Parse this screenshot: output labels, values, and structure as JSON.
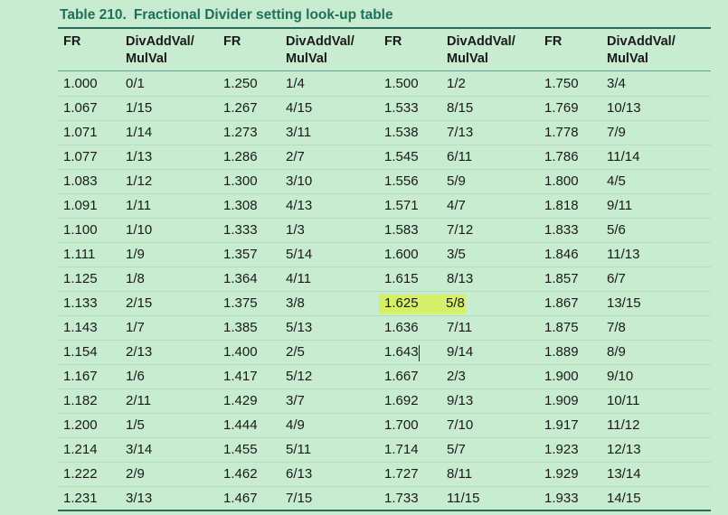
{
  "caption": {
    "number": "Table 210.",
    "title": "Fractional Divider setting look-up table"
  },
  "headers": {
    "fr": "FR",
    "div_line1": "DivAddVal/",
    "div_line2": "MulVal"
  },
  "highlight": {
    "group": 2,
    "row": 9,
    "color": "#d7f06b"
  },
  "groups": [
    {
      "rows": [
        [
          "1.000",
          "0/1"
        ],
        [
          "1.067",
          "1/15"
        ],
        [
          "1.071",
          "1/14"
        ],
        [
          "1.077",
          "1/13"
        ],
        [
          "1.083",
          "1/12"
        ],
        [
          "1.091",
          "1/11"
        ],
        [
          "1.100",
          "1/10"
        ],
        [
          "1.111",
          "1/9"
        ],
        [
          "1.125",
          "1/8"
        ],
        [
          "1.133",
          "2/15"
        ],
        [
          "1.143",
          "1/7"
        ],
        [
          "1.154",
          "2/13"
        ],
        [
          "1.167",
          "1/6"
        ],
        [
          "1.182",
          "2/11"
        ],
        [
          "1.200",
          "1/5"
        ],
        [
          "1.214",
          "3/14"
        ],
        [
          "1.222",
          "2/9"
        ],
        [
          "1.231",
          "3/13"
        ]
      ]
    },
    {
      "rows": [
        [
          "1.250",
          "1/4"
        ],
        [
          "1.267",
          "4/15"
        ],
        [
          "1.273",
          "3/11"
        ],
        [
          "1.286",
          "2/7"
        ],
        [
          "1.300",
          "3/10"
        ],
        [
          "1.308",
          "4/13"
        ],
        [
          "1.333",
          "1/3"
        ],
        [
          "1.357",
          "5/14"
        ],
        [
          "1.364",
          "4/11"
        ],
        [
          "1.375",
          "3/8"
        ],
        [
          "1.385",
          "5/13"
        ],
        [
          "1.400",
          "2/5"
        ],
        [
          "1.417",
          "5/12"
        ],
        [
          "1.429",
          "3/7"
        ],
        [
          "1.444",
          "4/9"
        ],
        [
          "1.455",
          "5/11"
        ],
        [
          "1.462",
          "6/13"
        ],
        [
          "1.467",
          "7/15"
        ]
      ]
    },
    {
      "rows": [
        [
          "1.500",
          "1/2"
        ],
        [
          "1.533",
          "8/15"
        ],
        [
          "1.538",
          "7/13"
        ],
        [
          "1.545",
          "6/11"
        ],
        [
          "1.556",
          "5/9"
        ],
        [
          "1.571",
          "4/7"
        ],
        [
          "1.583",
          "7/12"
        ],
        [
          "1.600",
          "3/5"
        ],
        [
          "1.615",
          "8/13"
        ],
        [
          "1.625",
          "5/8"
        ],
        [
          "1.636",
          "7/11"
        ],
        [
          "1.643",
          "9/14"
        ],
        [
          "1.667",
          "2/3"
        ],
        [
          "1.692",
          "9/13"
        ],
        [
          "1.700",
          "7/10"
        ],
        [
          "1.714",
          "5/7"
        ],
        [
          "1.727",
          "8/11"
        ],
        [
          "1.733",
          "11/15"
        ]
      ]
    },
    {
      "rows": [
        [
          "1.750",
          "3/4"
        ],
        [
          "1.769",
          "10/13"
        ],
        [
          "1.778",
          "7/9"
        ],
        [
          "1.786",
          "11/14"
        ],
        [
          "1.800",
          "4/5"
        ],
        [
          "1.818",
          "9/11"
        ],
        [
          "1.833",
          "5/6"
        ],
        [
          "1.846",
          "11/13"
        ],
        [
          "1.857",
          "6/7"
        ],
        [
          "1.867",
          "13/15"
        ],
        [
          "1.875",
          "7/8"
        ],
        [
          "1.889",
          "8/9"
        ],
        [
          "1.900",
          "9/10"
        ],
        [
          "1.909",
          "10/11"
        ],
        [
          "1.917",
          "11/12"
        ],
        [
          "1.923",
          "12/13"
        ],
        [
          "1.929",
          "13/14"
        ],
        [
          "1.933",
          "14/15"
        ]
      ]
    }
  ]
}
